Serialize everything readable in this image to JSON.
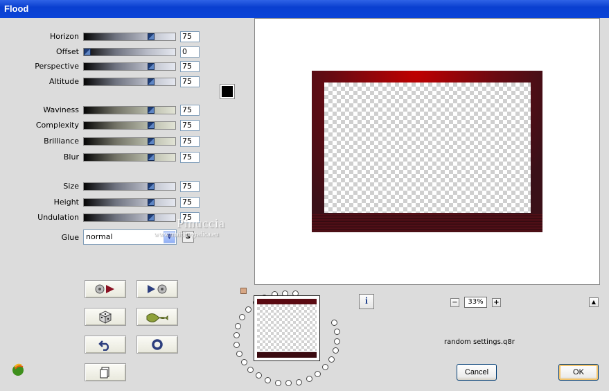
{
  "window": {
    "title": "Flood"
  },
  "sliders": [
    {
      "label": "Horizon",
      "value": "75"
    },
    {
      "label": "Offset",
      "value": "0"
    },
    {
      "label": "Perspective",
      "value": "75"
    },
    {
      "label": "Altitude",
      "value": "75"
    },
    {
      "label": "Waviness",
      "value": "75"
    },
    {
      "label": "Complexity",
      "value": "75"
    },
    {
      "label": "Brilliance",
      "value": "75"
    },
    {
      "label": "Blur",
      "value": "75"
    },
    {
      "label": "Size",
      "value": "75"
    },
    {
      "label": "Height",
      "value": "75"
    },
    {
      "label": "Undulation",
      "value": "75"
    }
  ],
  "glue": {
    "label": "Glue",
    "value": "normal",
    "s_button": "S"
  },
  "color_swatch": "#000000",
  "preview": {
    "zoom": "33%",
    "frame_color": "#8b0a14"
  },
  "preset": {
    "filename": "random settings.q8r"
  },
  "buttons": {
    "cancel": "Cancel",
    "ok": "OK"
  },
  "watermark": {
    "name": "Pinuccia",
    "site": "www.maidiregrafica.eu"
  }
}
